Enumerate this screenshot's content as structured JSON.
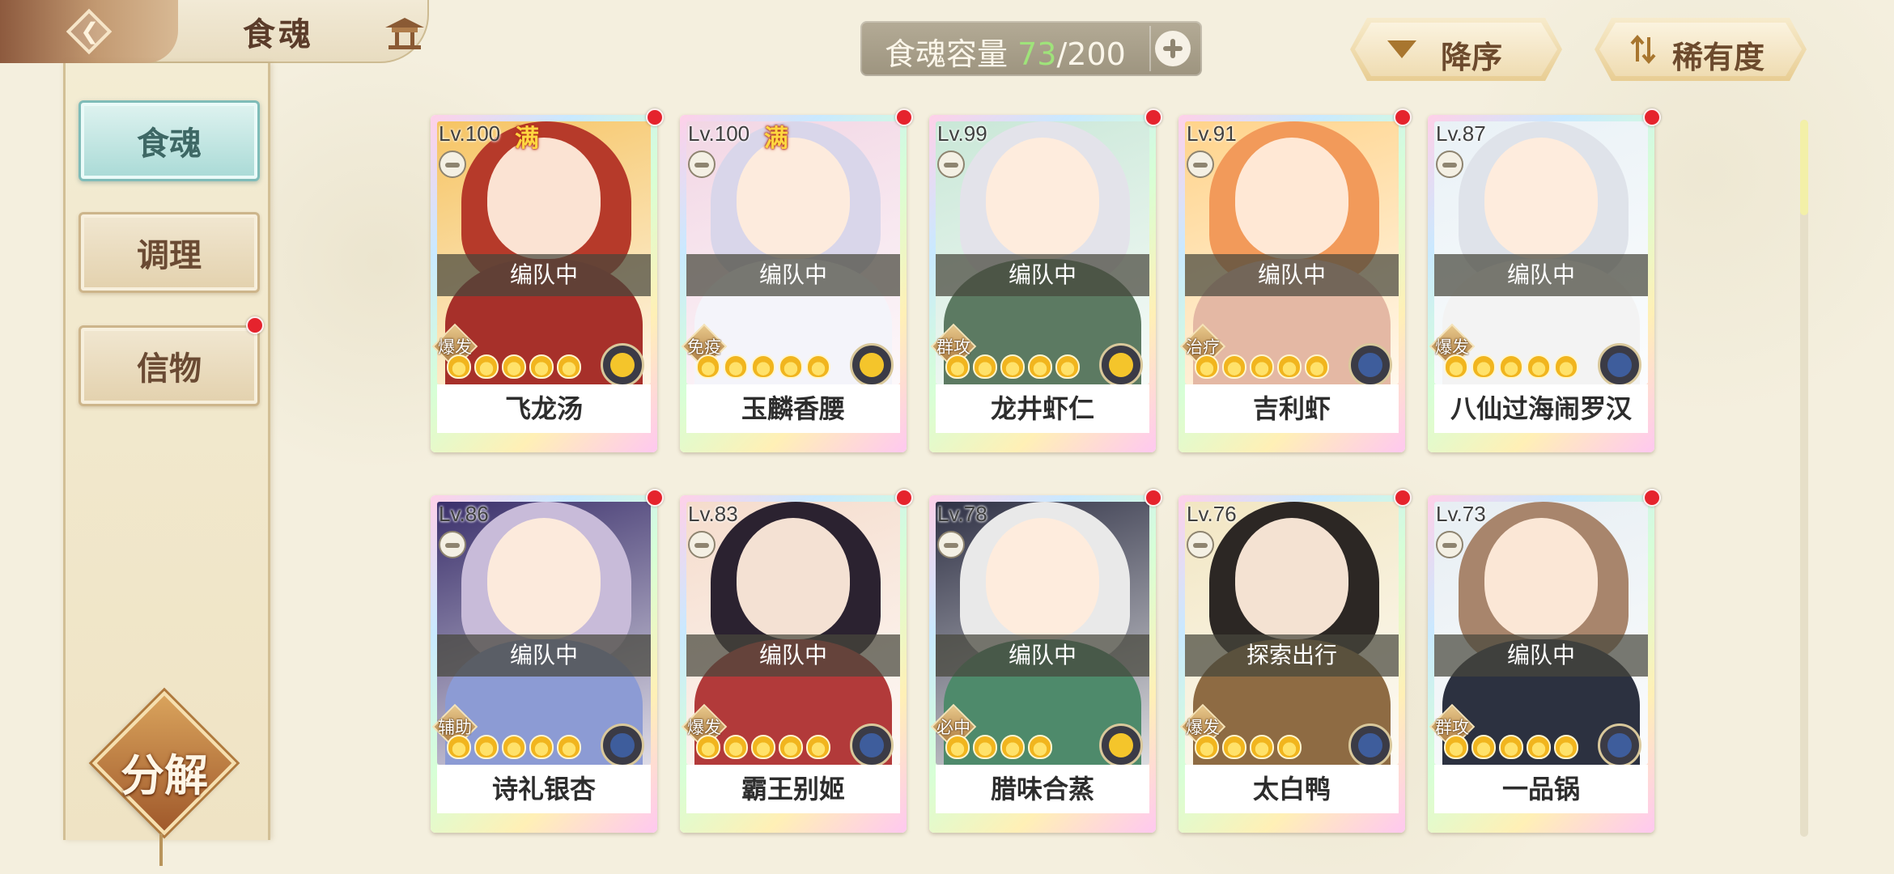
{
  "header": {
    "title": "食魂"
  },
  "sidebar": {
    "tabs": [
      {
        "label": "食魂",
        "active": true,
        "notification": false
      },
      {
        "label": "调理",
        "active": false,
        "notification": false
      },
      {
        "label": "信物",
        "active": false,
        "notification": true
      }
    ],
    "decompose_label": "分解"
  },
  "capacity": {
    "label": "食魂容量",
    "current": "73",
    "total": "/200"
  },
  "sort": {
    "order_label": "降序",
    "rarity_label": "稀有度"
  },
  "cards": [
    {
      "level": "Lv.100",
      "maxed": true,
      "status": "编队中",
      "role": "爆发",
      "stars": 5,
      "name": "飞龙汤",
      "element": "gold",
      "notification": true
    },
    {
      "level": "Lv.100",
      "maxed": true,
      "status": "编队中",
      "role": "免疫",
      "stars": 5,
      "name": "玉麟香腰",
      "element": "gold",
      "notification": true
    },
    {
      "level": "Lv.99",
      "maxed": false,
      "status": "编队中",
      "role": "群攻",
      "stars": 5,
      "name": "龙井虾仁",
      "element": "gold",
      "notification": true
    },
    {
      "level": "Lv.91",
      "maxed": false,
      "status": "编队中",
      "role": "治疗",
      "stars": 5,
      "name": "吉利虾",
      "element": "blue",
      "notification": true
    },
    {
      "level": "Lv.87",
      "maxed": false,
      "status": "编队中",
      "role": "爆发",
      "stars": 5,
      "name": "八仙过海闹罗汉",
      "element": "blue",
      "notification": true
    },
    {
      "level": "Lv.86",
      "maxed": false,
      "status": "编队中",
      "role": "辅助",
      "stars": 5,
      "name": "诗礼银杏",
      "element": "blue",
      "notification": true
    },
    {
      "level": "Lv.83",
      "maxed": false,
      "status": "编队中",
      "role": "爆发",
      "stars": 5,
      "name": "霸王别姬",
      "element": "blue",
      "notification": true
    },
    {
      "level": "Lv.78",
      "maxed": false,
      "status": "编队中",
      "role": "必中",
      "stars": 4,
      "name": "腊味合蒸",
      "element": "gold",
      "notification": true
    },
    {
      "level": "Lv.76",
      "maxed": false,
      "status": "探索出行",
      "role": "爆发",
      "stars": 4,
      "name": "太白鸭",
      "element": "blue",
      "notification": true
    },
    {
      "level": "Lv.73",
      "maxed": false,
      "status": "编队中",
      "role": "群攻",
      "stars": 5,
      "name": "一品锅",
      "element": "blue",
      "notification": true
    }
  ],
  "colors": {
    "full_badge": "满",
    "capacity_current": "#9fe37a",
    "element_gold": "#f4c52b",
    "element_blue": "#3e5d9c"
  }
}
